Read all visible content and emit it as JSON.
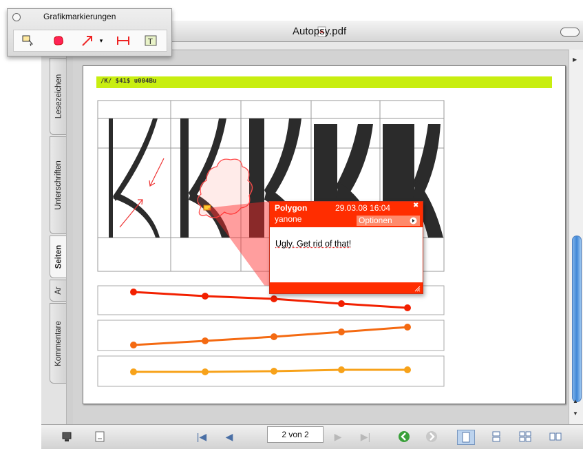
{
  "window": {
    "title": "Autopsy.pdf"
  },
  "graphics_palette": {
    "title": "Grafikmarkierungen",
    "tools": [
      "rectangle-select-icon",
      "polygon-icon",
      "arrow-icon",
      "dropdown-icon",
      "measure-icon",
      "textbox-icon"
    ]
  },
  "sidebar": {
    "tabs": [
      {
        "label": "Lesezeichen",
        "active": false
      },
      {
        "label": "Unterschriften",
        "active": false
      },
      {
        "label": "Seiten",
        "active": true
      },
      {
        "label": "Ar",
        "active": false
      },
      {
        "label": "Kommentare",
        "active": false
      }
    ]
  },
  "document": {
    "banner_text": "/K/ $41$ u004Bu",
    "banner_color": "#c8ee10"
  },
  "annotation": {
    "type": "Polygon",
    "date": "29.03.08 16:04",
    "author": "yanone",
    "options_label": "Optionen",
    "comment": "Ugly. Get rid of that!",
    "color": "#ff2d00"
  },
  "navigation": {
    "page_indicator": "2 von 2"
  },
  "accent": "#3f86d6"
}
